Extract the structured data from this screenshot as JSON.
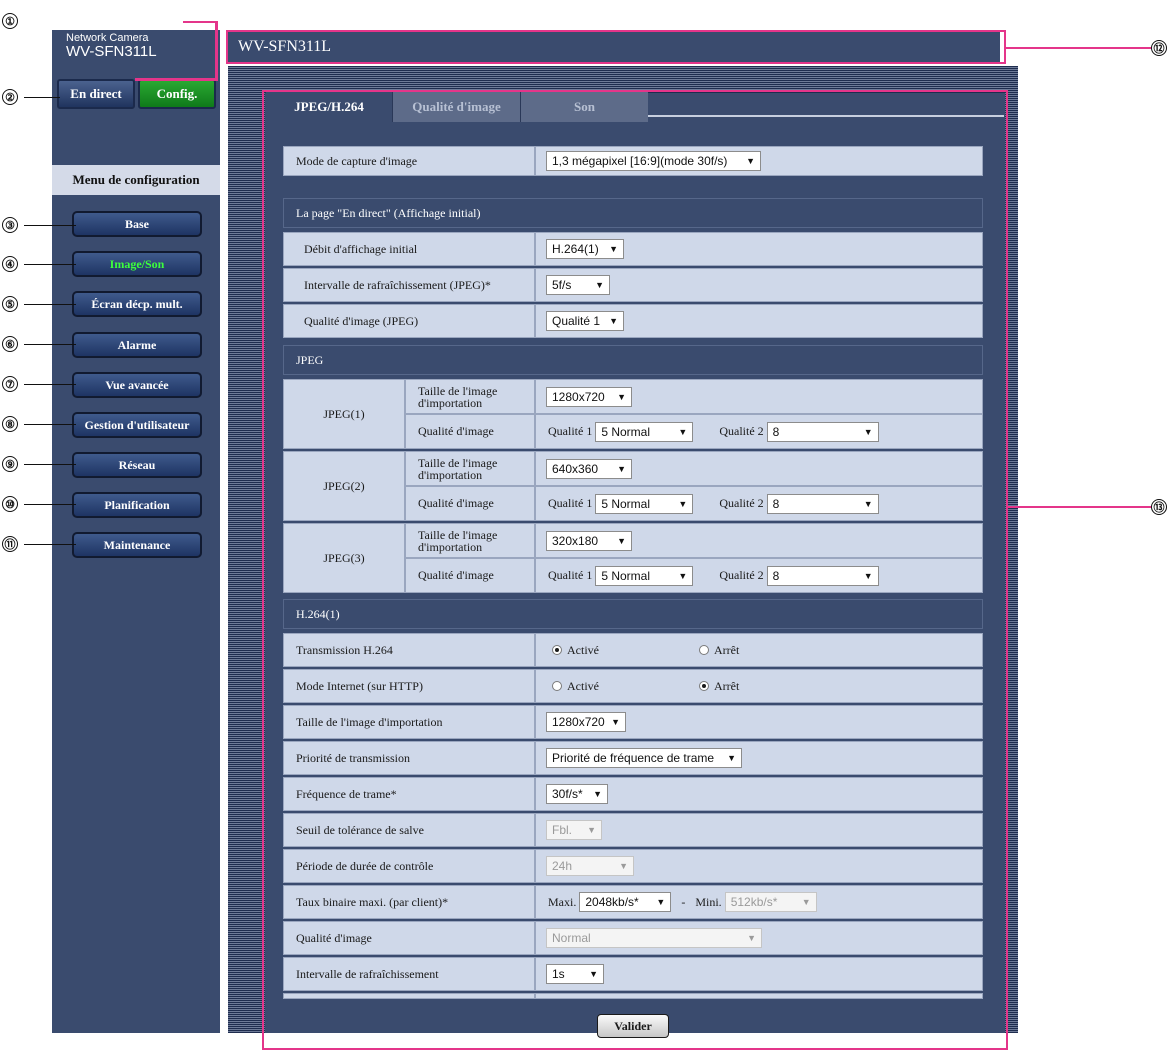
{
  "brand": {
    "line1": "Network Camera",
    "line2": "WV-SFN311L"
  },
  "top_buttons": {
    "live": "En direct",
    "config": "Config."
  },
  "menu": {
    "title": "Menu de configuration",
    "items": [
      "Base",
      "Image/Son",
      "Écran décp. mult.",
      "Alarme",
      "Vue avancée",
      "Gestion d'utilisateur",
      "Réseau",
      "Planification",
      "Maintenance"
    ],
    "active": "Image/Son"
  },
  "header": {
    "title": "WV-SFN311L"
  },
  "tabs": [
    "JPEG/H.264",
    "Qualité d'image",
    "Son"
  ],
  "capture": {
    "label": "Mode de capture d'image",
    "value": "1,3 mégapixel [16:9](mode 30f/s)"
  },
  "live_page": {
    "title": "La page \"En direct\" (Affichage initial)",
    "rows": [
      {
        "label": "Débit d'affichage initial",
        "value": "H.264(1)"
      },
      {
        "label": "Intervalle de rafraîchissement (JPEG)*",
        "value": "5f/s"
      },
      {
        "label": "Qualité d'image (JPEG)",
        "value": "Qualité 1"
      }
    ]
  },
  "jpeg": {
    "title": "JPEG",
    "size_label": "Taille de l'image d'importation",
    "quality_label": "Qualité d'image",
    "q1_label": "Qualité 1",
    "q2_label": "Qualité 2",
    "streams": [
      {
        "name": "JPEG(1)",
        "size": "1280x720",
        "q1": "5 Normal",
        "q2": "8"
      },
      {
        "name": "JPEG(2)",
        "size": "640x360",
        "q1": "5 Normal",
        "q2": "8"
      },
      {
        "name": "JPEG(3)",
        "size": "320x180",
        "q1": "5 Normal",
        "q2": "8"
      }
    ]
  },
  "h264": {
    "title": "H.264(1)",
    "transmission": {
      "label": "Transmission H.264",
      "on": "Activé",
      "off": "Arrêt"
    },
    "internet": {
      "label": "Mode Internet (sur HTTP)",
      "on": "Activé",
      "off": "Arrêt"
    },
    "size": {
      "label": "Taille de l'image d'importation",
      "value": "1280x720"
    },
    "priority": {
      "label": "Priorité de transmission",
      "value": "Priorité de fréquence de trame"
    },
    "framerate": {
      "label": "Fréquence de trame*",
      "value": "30f/s*"
    },
    "burst": {
      "label": "Seuil de tolérance de salve",
      "value": "Fbl."
    },
    "period": {
      "label": "Période de durée de contrôle",
      "value": "24h"
    },
    "bitrate": {
      "label": "Taux binaire maxi. (par client)*",
      "max_label": "Maxi.",
      "max": "2048kb/s*",
      "sep": "-",
      "min_label": "Mini.",
      "min": "512kb/s*"
    },
    "quality": {
      "label": "Qualité d'image",
      "value": "Normal"
    },
    "refresh": {
      "label": "Intervalle de rafraîchissement",
      "value": "1s"
    }
  },
  "submit": "Valider",
  "callouts": [
    "①",
    "②",
    "③",
    "④",
    "⑤",
    "⑥",
    "⑦",
    "⑧",
    "⑨",
    "⑩",
    "⑪",
    "⑫",
    "⑬"
  ]
}
